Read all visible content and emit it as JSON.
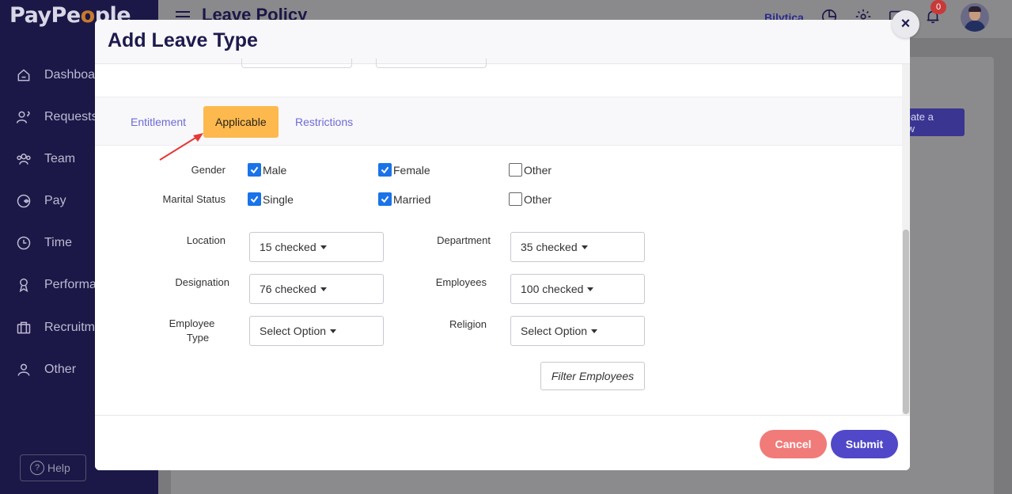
{
  "app": {
    "logo_left": "PayPe",
    "logo_dot": "o",
    "logo_right": "ple",
    "page_title": "Leave Policy",
    "company": "Bilytica",
    "notification_count": "0",
    "create_button": "Create a New",
    "help_label": "Help"
  },
  "sidebar": {
    "items": [
      {
        "label": "Dashboard",
        "icon": "home-icon"
      },
      {
        "label": "Requests",
        "icon": "requests-icon"
      },
      {
        "label": "Team",
        "icon": "team-icon"
      },
      {
        "label": "Pay",
        "icon": "pay-icon"
      },
      {
        "label": "Time",
        "icon": "clock-icon"
      },
      {
        "label": "Performance",
        "icon": "award-icon"
      },
      {
        "label": "Recruitment",
        "icon": "briefcase-icon"
      },
      {
        "label": "Other",
        "icon": "user-icon"
      }
    ]
  },
  "modal": {
    "title": "Add Leave Type",
    "close_symbol": "×",
    "tabs": [
      {
        "label": "Entitlement",
        "active": false
      },
      {
        "label": "Applicable",
        "active": true
      },
      {
        "label": "Restrictions",
        "active": false
      }
    ],
    "gender": {
      "label": "Gender",
      "options": [
        {
          "label": "Male",
          "checked": true
        },
        {
          "label": "Female",
          "checked": true
        },
        {
          "label": "Other",
          "checked": false
        }
      ]
    },
    "marital_status": {
      "label": "Marital Status",
      "options": [
        {
          "label": "Single",
          "checked": true
        },
        {
          "label": "Married",
          "checked": true
        },
        {
          "label": "Other",
          "checked": false
        }
      ]
    },
    "fields": {
      "location": {
        "label": "Location",
        "value": "15 checked"
      },
      "department": {
        "label": "Department",
        "value": "35 checked"
      },
      "designation": {
        "label": "Designation",
        "value": "76 checked"
      },
      "employees": {
        "label": "Employees",
        "value": "100 checked"
      },
      "employee_type": {
        "label_line1": "Employee",
        "label_line2": "Type",
        "value": "Select Option"
      },
      "religion": {
        "label": "Religion",
        "value": "Select Option"
      }
    },
    "filter_button": "Filter Employees",
    "cancel_button": "Cancel",
    "submit_button": "Submit"
  },
  "colors": {
    "sidebar_bg": "#1b1747",
    "active_tab": "#fdb94e",
    "tab_link": "#6d6ad6",
    "checkbox": "#1a73e8",
    "cancel": "#f07b79",
    "submit": "#5048c8",
    "arrow": "#e53935"
  }
}
